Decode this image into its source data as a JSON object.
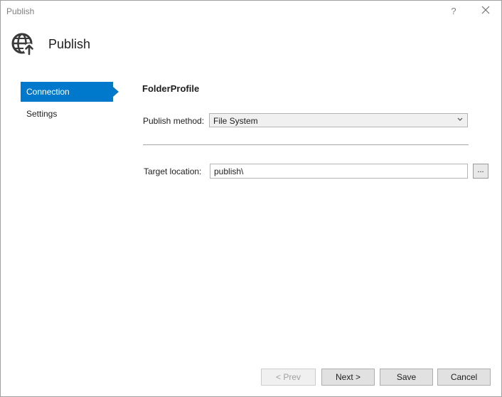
{
  "window": {
    "title": "Publish",
    "help_label": "?"
  },
  "header": {
    "title": "Publish",
    "icon": "globe-publish-icon"
  },
  "nav": {
    "items": [
      {
        "label": "Connection",
        "active": true
      },
      {
        "label": "Settings",
        "active": false
      }
    ]
  },
  "connection": {
    "profile_name": "FolderProfile",
    "publish_method_label": "Publish method:",
    "publish_method_value": "File System",
    "target_location_label": "Target location:",
    "target_location_value": "publish\\",
    "browse_label": "..."
  },
  "footer": {
    "prev_label": "< Prev",
    "next_label": "Next >",
    "save_label": "Save",
    "cancel_label": "Cancel"
  },
  "colors": {
    "accent": "#0079cc"
  }
}
